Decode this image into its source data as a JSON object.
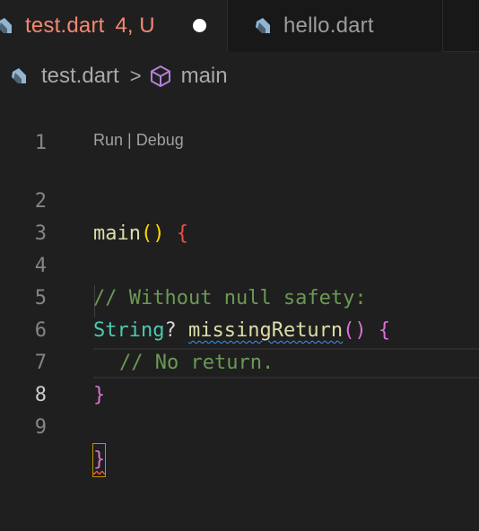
{
  "tabs": [
    {
      "title": "test.dart",
      "badge": "4, U",
      "active": true,
      "dirty": true,
      "icon": "dart-icon"
    },
    {
      "title": "hello.dart",
      "active": false,
      "icon": "dart-icon"
    }
  ],
  "breadcrumb": {
    "file": "test.dart",
    "separator": ">",
    "symbol": "main",
    "file_icon": "dart-icon",
    "symbol_icon": "cube-icon"
  },
  "editor": {
    "current_line": 8,
    "codelens": "Run | Debug",
    "line_numbers": [
      "1",
      "2",
      "3",
      "4",
      "5",
      "6",
      "7",
      "8",
      "9"
    ],
    "line2": {
      "fn": "main",
      "parens": "()",
      "brace": "{"
    },
    "line4": {
      "comment": "// Without null safety:"
    },
    "line5": {
      "type": "String",
      "nullable": "?",
      "fn": "missingReturn",
      "parens": "()",
      "brace": "{"
    },
    "line6": {
      "comment": "// No return."
    },
    "line7": {
      "brace": "}"
    },
    "line9": {
      "brace": "}"
    }
  },
  "colors": {
    "tab_modified": "#f48771",
    "dart_icon": "#8fb6d4",
    "function": "#dcdcaa",
    "comment": "#6a9955",
    "type": "#4ec9b0",
    "bracket_1": "#ffd700",
    "bracket_2": "#da70d6",
    "error": "#f14c4c",
    "warning_squiggle": "#3794ff"
  }
}
